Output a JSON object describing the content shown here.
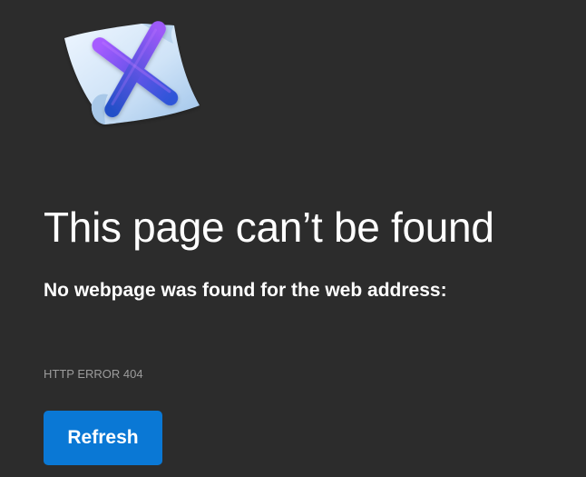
{
  "error_page": {
    "icon": "broken-page-x-icon",
    "title": "This page can’t be found",
    "message": "No webpage was found for the web address:",
    "error_code": "HTTP ERROR 404",
    "refresh_label": "Refresh"
  },
  "colors": {
    "background": "#2c2c2c",
    "text": "#ffffff",
    "muted_text": "#9c9c9c",
    "button": "#0a78d5",
    "icon_paper": "#cfe3f7",
    "icon_x": "#5b55d9"
  }
}
